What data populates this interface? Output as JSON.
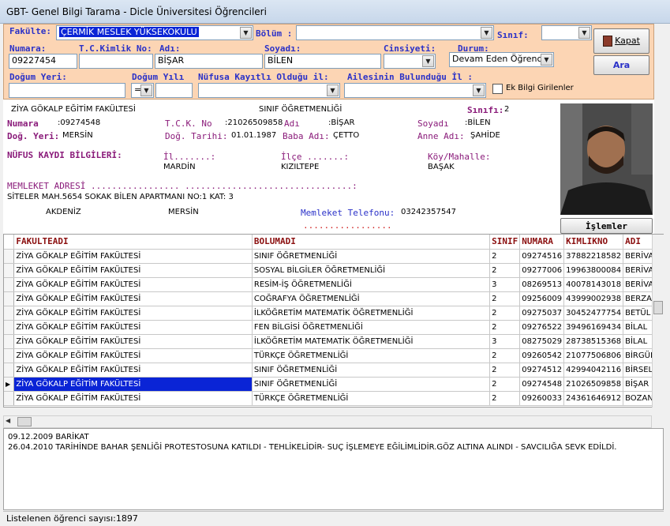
{
  "window": {
    "title": "GBT- Genel Bilgi Tarama - Dicle Üniversitesi Öğrencileri"
  },
  "filters": {
    "fakulte_label": "Fakülte:",
    "fakulte_value": "ÇERMİK MESLEK YÜKSEKOKULU",
    "bolum_label": "Bölüm :",
    "bolum_value": "",
    "sinif_label": "Sınıf:",
    "sinif_value": "",
    "numara_label": "Numara:",
    "numara_value": "09227454",
    "tc_label": "T.C.Kimlik No:",
    "tc_value": "",
    "adi_label": "Adı:",
    "adi_value": "BİŞAR",
    "soyadi_label": "Soyadı:",
    "soyadi_value": "BİLEN",
    "cinsiyet_label": "Cinsiyeti:",
    "cinsiyet_value": "",
    "durum_label": "Durum:",
    "durum_value": "Devam Eden Öğrenci",
    "dogum_yeri_label": "Doğum Yeri:",
    "dogum_yeri_value": "",
    "dogum_yili_label": "Doğum Yılı",
    "dogum_yili_op": "=",
    "dogum_yili_value": "",
    "nufus_il_label": "Nüfusa Kayıtlı Olduğu il:",
    "nufus_il_value": "",
    "aile_il_label": "Ailesinin Bulunduğu İl :",
    "aile_il_value": "",
    "ek_bilgi_label": "Ek Bilgi Girilenler"
  },
  "buttons": {
    "kapat": "Kapat",
    "ara": "Ara",
    "islemler": "İşlemler"
  },
  "student": {
    "fakulte": "ZİYA GÖKALP EĞİTİM FAKÜLTESİ",
    "bolum": "SINIF ÖĞRETMENLİĞİ",
    "sinif_label": "Sınıfı:",
    "sinif": "2",
    "numara_label": "Numara",
    "numara": ":09274548",
    "tck_label": "T.C.K. No",
    "tck": ":21026509858",
    "adi_label": "Adı",
    "adi": ":BİŞAR",
    "soyadi_label": "Soyadı",
    "soyadi": ":BİLEN",
    "dog_yeri_label": "Doğ. Yeri:",
    "dog_yeri": "MERSİN",
    "dog_tarihi_label": "Doğ. Tarihi:",
    "dog_tarihi": "01.01.1987",
    "baba_label": "Baba Adı:",
    "baba": "ÇETTO",
    "anne_label": "Anne Adı:",
    "anne": "ŞAHİDE",
    "nufus_title": "NÜFUS KAYDI BİLGİLERİ:",
    "il_label": "İl.......:",
    "il": "MARDİN",
    "ilce_label": "İlçe .......:",
    "ilce": "KIZILTEPE",
    "koy_label": "Köy/Mahalle:",
    "koy": "BAŞAK",
    "memleket_label": "MEMLEKET ADRESİ ................. ................................:",
    "memleket_adres": "SİTELER MAH.5654 SOKAK BİLEN APARTMANI NO:1 KAT: 3",
    "mem_ilce": "AKDENİZ",
    "mem_il": "MERSİN",
    "tel_label": "Memleket Telefonu:",
    "tel": "03242357547",
    "dots": "................."
  },
  "table": {
    "headers": [
      "FAKULTEADI",
      "BOLUMADI",
      "SINIF",
      "NUMARA",
      "KIMLIKNO",
      "ADI"
    ],
    "rows": [
      [
        "ZİYA GÖKALP EĞİTİM FAKÜLTESİ",
        "SINIF ÖĞRETMENLİĞİ",
        "2",
        "09274516",
        "37882218582",
        "BERİVA"
      ],
      [
        "ZİYA GÖKALP EĞİTİM FAKÜLTESİ",
        "SOSYAL BİLGİLER ÖĞRETMENLİĞİ",
        "2",
        "09277006",
        "19963800084",
        "BERİVA"
      ],
      [
        "ZİYA GÖKALP EĞİTİM FAKÜLTESİ",
        "RESİM-İŞ ÖĞRETMENLİĞİ",
        "3",
        "08269513",
        "40078143018",
        "BERİVA"
      ],
      [
        "ZİYA GÖKALP EĞİTİM FAKÜLTESİ",
        "COĞRAFYA ÖĞRETMENLİĞİ",
        "2",
        "09256009",
        "43999002938",
        "BERZAN"
      ],
      [
        "ZİYA GÖKALP EĞİTİM FAKÜLTESİ",
        "İLKÖĞRETİM MATEMATİK ÖĞRETMENLİĞİ",
        "2",
        "09275037",
        "30452477754",
        "BETÜL"
      ],
      [
        "ZİYA GÖKALP EĞİTİM FAKÜLTESİ",
        "FEN BİLGİSİ ÖĞRETMENLİĞİ",
        "2",
        "09276522",
        "39496169434",
        "BİLAL"
      ],
      [
        "ZİYA GÖKALP EĞİTİM FAKÜLTESİ",
        "İLKÖĞRETİM MATEMATİK ÖĞRETMENLİĞİ",
        "3",
        "08275029",
        "28738515368",
        "BİLAL"
      ],
      [
        "ZİYA GÖKALP EĞİTİM FAKÜLTESİ",
        "TÜRKÇE ÖĞRETMENLİĞİ",
        "2",
        "09260542",
        "21077506806",
        "BİRGÜL"
      ],
      [
        "ZİYA GÖKALP EĞİTİM FAKÜLTESİ",
        "SINIF ÖĞRETMENLİĞİ",
        "2",
        "09274512",
        "42994042116",
        "BİRSEL"
      ],
      [
        "ZİYA GÖKALP EĞİTİM FAKÜLTESİ",
        "SINIF ÖĞRETMENLİĞİ",
        "2",
        "09274548",
        "21026509858",
        "BİŞAR"
      ],
      [
        "ZİYA GÖKALP EĞİTİM FAKÜLTESİ",
        "TÜRKÇE ÖĞRETMENLİĞİ",
        "2",
        "09260033",
        "24361646912",
        "BOZAN"
      ]
    ],
    "current_row": 9
  },
  "notes": {
    "line1": "09.12.2009 BARİKAT",
    "line2": "26.04.2010 TARİHİNDE BAHAR ŞENLİĞİ  PROTESTOSUNA KATILDI - TEHLİKELİDİR-  SUÇ İŞLEMEYE EĞİLİMLİDİR.GÖZ ALTINA ALINDI      -      SAVCILIĞA SEVK EDİLDİ."
  },
  "status": {
    "text": "Listelenen öğrenci sayısı:1897"
  }
}
